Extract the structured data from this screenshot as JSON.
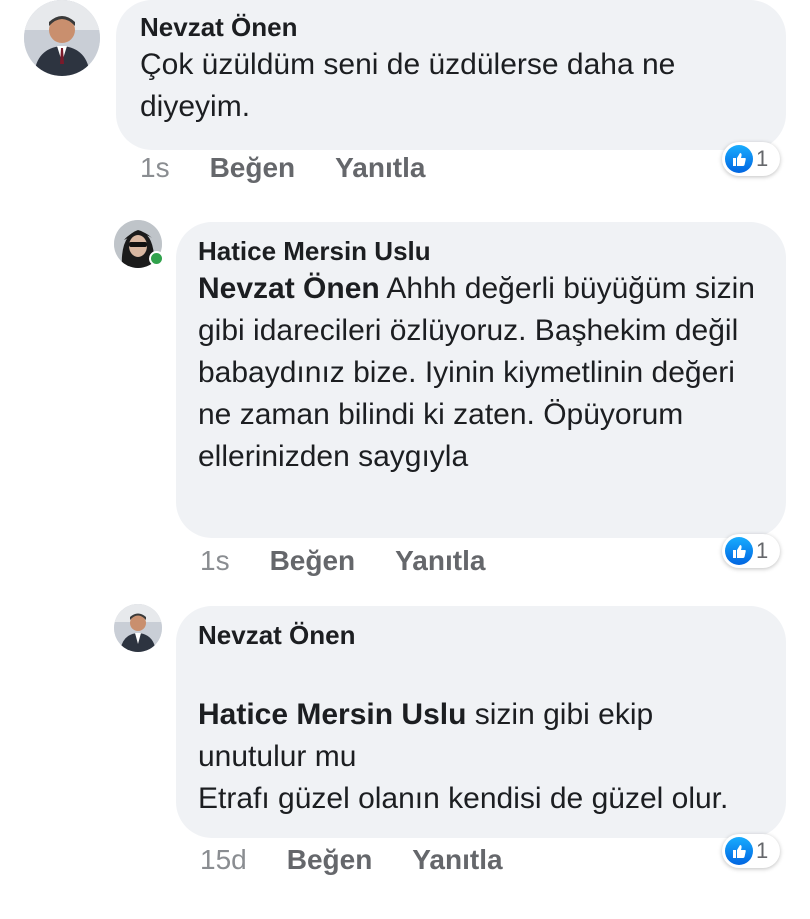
{
  "comments": [
    {
      "author": "Nevzat Önen",
      "mention": "",
      "text": "Çok üzüldüm seni de üzdülerse daha ne diyeyim.",
      "time": "1s",
      "like_label": "Beğen",
      "reply_label": "Yanıtla",
      "reaction_count": "1",
      "reaction_icon": "like-icon"
    },
    {
      "author": "Hatice Mersin Uslu",
      "mention": "Nevzat Önen",
      "text": "Ahhh değerli büyüğüm sizin gibi idarecileri özlüyoruz. Başhekim değil babaydınız bize. Iyinin kiymetlinin değeri ne zaman bilindi ki zaten. Öpüyorum ellerinizden saygıyla",
      "time": "1s",
      "like_label": "Beğen",
      "reply_label": "Yanıtla",
      "reaction_count": "1",
      "reaction_icon": "like-icon",
      "online": true
    },
    {
      "author": "Nevzat Önen",
      "mention": "Hatice Mersin Uslu",
      "text": "sizin gibi ekip unutulur mu\nEtrafı güzel olanın kendisi de güzel olur.",
      "time": "15d",
      "like_label": "Beğen",
      "reply_label": "Yanıtla",
      "reaction_count": "1",
      "reaction_icon": "like-icon"
    }
  ],
  "colors": {
    "bubble": "#f0f2f5",
    "meta_text": "#65676b",
    "like_blue": "#0866ff",
    "online_green": "#31a24c"
  }
}
